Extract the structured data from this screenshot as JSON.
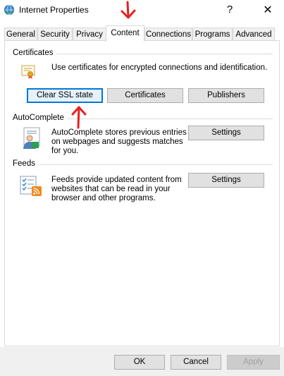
{
  "window": {
    "title": "Internet Properties"
  },
  "titlebar": {
    "help_glyph": "?",
    "close_glyph": "✕"
  },
  "tabs": [
    {
      "label": "General"
    },
    {
      "label": "Security"
    },
    {
      "label": "Privacy"
    },
    {
      "label": "Content",
      "active": true
    },
    {
      "label": "Connections"
    },
    {
      "label": "Programs"
    },
    {
      "label": "Advanced"
    }
  ],
  "certificates": {
    "heading": "Certificates",
    "description": "Use certificates for encrypted connections and identification.",
    "clear_ssl_label": "Clear SSL state",
    "certificates_label": "Certificates",
    "publishers_label": "Publishers",
    "icon": "certificate-icon"
  },
  "autocomplete": {
    "heading": "AutoComplete",
    "description_lines": [
      "AutoComplete stores previous entries",
      "on webpages and suggests matches",
      "for you."
    ],
    "settings_label": "Settings",
    "icon": "user-form-icon"
  },
  "feeds": {
    "heading": "Feeds",
    "description_lines": [
      "Feeds provide updated content from",
      "websites that can be read in your",
      "browser and other programs."
    ],
    "settings_label": "Settings",
    "icon": "feeds-icon"
  },
  "footer": {
    "ok_label": "OK",
    "cancel_label": "Cancel",
    "apply_label": "Apply",
    "apply_enabled": false
  },
  "annotations": {
    "arrow_color": "#e8201f"
  },
  "colors": {
    "focus_blue": "#0078d7",
    "button_face": "#e1e1e1",
    "dialog_bg": "#f0f0f0"
  }
}
